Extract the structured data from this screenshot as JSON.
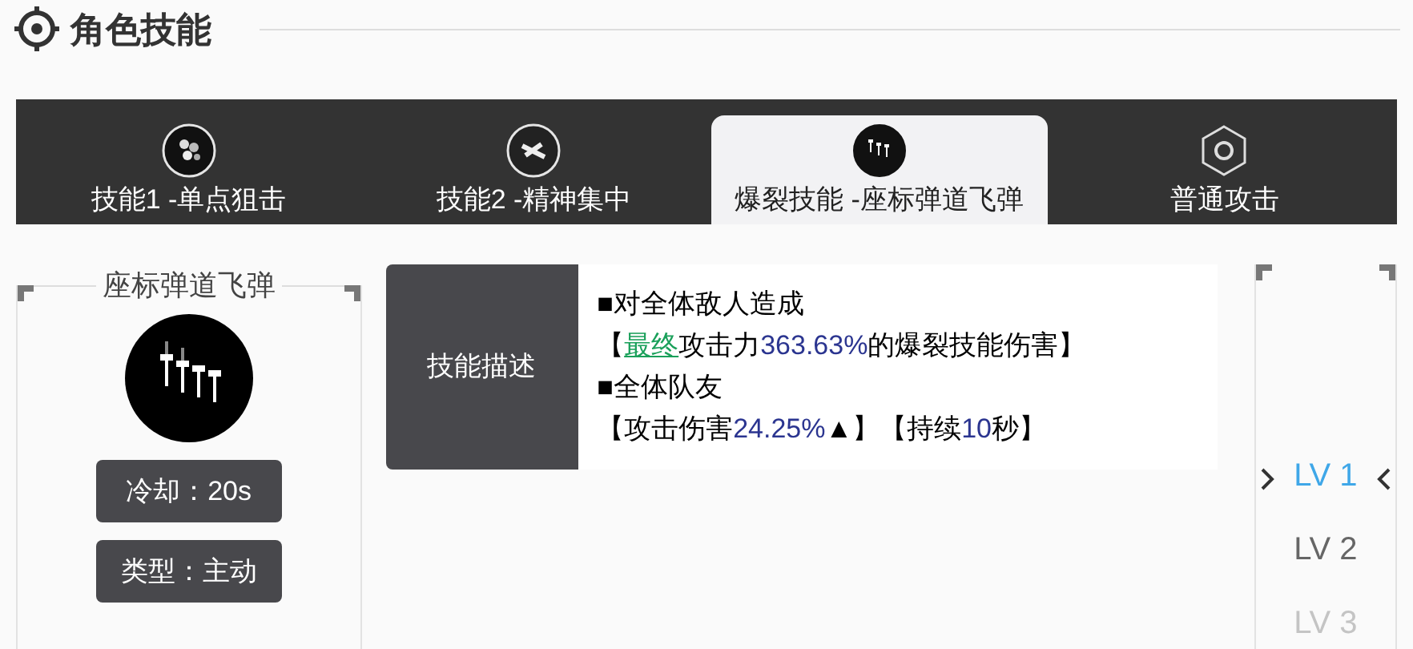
{
  "header": {
    "title": "角色技能"
  },
  "tabs": [
    {
      "label": "技能1 -单点狙击",
      "selected": false,
      "kind": "burst"
    },
    {
      "label": "技能2 -精神集中",
      "selected": false,
      "kind": "focus"
    },
    {
      "label": "爆裂技能 -座标弹道飞弹",
      "selected": true,
      "kind": "missile"
    },
    {
      "label": "普通攻击",
      "selected": false,
      "kind": "hex"
    }
  ],
  "skill_card": {
    "title": "座标弹道飞弹",
    "badges": [
      "冷却：20s",
      "类型：主动"
    ]
  },
  "description": {
    "label": "技能描述",
    "lines": [
      [
        {
          "kind": "plain",
          "text": "■对全体敌人造成"
        }
      ],
      [
        {
          "kind": "plain",
          "text": "【"
        },
        {
          "kind": "link",
          "text": "最终"
        },
        {
          "kind": "plain",
          "text": "攻击力"
        },
        {
          "kind": "number",
          "text": "363.63%"
        },
        {
          "kind": "plain",
          "text": "的爆裂技能伤害】"
        }
      ],
      [
        {
          "kind": "plain",
          "text": "■全体队友"
        }
      ],
      [
        {
          "kind": "plain",
          "text": "【攻击伤害"
        },
        {
          "kind": "number",
          "text": "24.25%"
        },
        {
          "kind": "plain",
          "text": "▲】【持续"
        },
        {
          "kind": "number",
          "text": "10"
        },
        {
          "kind": "plain",
          "text": "秒】"
        }
      ]
    ]
  },
  "levels": [
    {
      "label": "LV 1",
      "selected": true
    },
    {
      "label": "LV 2",
      "selected": false
    },
    {
      "label": "LV 3",
      "selected": false
    }
  ]
}
